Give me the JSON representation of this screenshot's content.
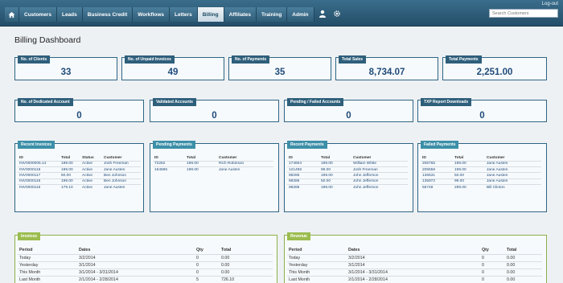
{
  "header": {
    "logout": "Log-out",
    "nav": [
      "Customers",
      "Leads",
      "Business Credit",
      "Workflows",
      "Letters",
      "Billing",
      "Affiliates",
      "Training",
      "Admin"
    ],
    "active": "Billing",
    "search_placeholder": "Search Customers"
  },
  "page_title": "Billing Dashboard",
  "stats_row1": [
    {
      "label": "No. of Clients",
      "value": "33"
    },
    {
      "label": "No. of Unpaid Invoices",
      "value": "49"
    },
    {
      "label": "No. of Payments",
      "value": "35"
    },
    {
      "label": "Total Sales",
      "value": "8,734.07"
    },
    {
      "label": "Total Payments",
      "value": "2,251.00"
    }
  ],
  "stats_row2": [
    {
      "label": "No. of Dedicated Account",
      "value": "0"
    },
    {
      "label": "Validated Accounts",
      "value": "0"
    },
    {
      "label": "Pending / Failed Accounts",
      "value": "0"
    },
    {
      "label": "TXP Report Downloads",
      "value": "0"
    }
  ],
  "recent_invoices": {
    "title": "Recent Invoices",
    "headers": [
      "ID",
      "Total",
      "Status",
      "Customer"
    ],
    "rows": [
      [
        "INV0000005.14",
        "199.00",
        "Active",
        "Josh Freeman"
      ],
      [
        "INV0000118",
        "199.00",
        "Active",
        "Jane Austen"
      ],
      [
        "INV0000117",
        "50.00",
        "Active",
        "Ben Johnson"
      ],
      [
        "INV0000116",
        "199.00",
        "Active",
        "Ben Johnson"
      ],
      [
        "INV0000115",
        "179.10",
        "Active",
        "Jane Austen"
      ]
    ]
  },
  "pending_payments": {
    "title": "Pending Payments",
    "headers": [
      "ID",
      "Total",
      "Customer"
    ],
    "rows": [
      [
        "72262",
        "199.00",
        "Rich Robinson"
      ],
      [
        "164596",
        "199.00",
        "Jane Austen"
      ]
    ]
  },
  "recent_payments": {
    "title": "Recent Payments",
    "headers": [
      "ID",
      "Total",
      "Customer"
    ],
    "rows": [
      [
        "174604",
        "199.00",
        "William White"
      ],
      [
        "121459",
        "99.00",
        "Josh Freeman"
      ],
      [
        "98295",
        "199.00",
        "John Jefferson"
      ],
      [
        "98286",
        "50.00",
        "John Jefferson"
      ],
      [
        "98285",
        "199.00",
        "John Jefferson"
      ]
    ]
  },
  "failed_payments": {
    "title": "Failed Payments",
    "headers": [
      "ID",
      "Total",
      "Customer"
    ],
    "rows": [
      [
        "206765",
        "199.00",
        "Jane Austen"
      ],
      [
        "205558",
        "199.00",
        "Jane Austen"
      ],
      [
        "136531",
        "50.00",
        "Jane Austen"
      ],
      [
        "135972",
        "99.00",
        "Jane Austen"
      ],
      [
        "56748",
        "299.00",
        "Bill Clinton"
      ]
    ]
  },
  "invoices": {
    "title": "Invoices",
    "headers": [
      "Period",
      "Dates",
      "Qty",
      "Total"
    ],
    "rows": [
      [
        "Today",
        "3/2/2014",
        "0",
        "0.00"
      ],
      [
        "Yesterday",
        "3/1/2014",
        "0",
        "0.00"
      ],
      [
        "This Month",
        "3/1/2014 - 3/31/2014",
        "0",
        "0.00"
      ],
      [
        "Last Month",
        "2/1/2014 - 2/28/2014",
        "5",
        "726.10"
      ]
    ]
  },
  "revenue": {
    "title": "Revenue",
    "headers": [
      "Period",
      "Dates",
      "Qty",
      "Total"
    ],
    "rows": [
      [
        "Today",
        "3/2/2014",
        "0",
        "0.00"
      ],
      [
        "Yesterday",
        "3/1/2014",
        "0",
        "0.00"
      ],
      [
        "This Month",
        "3/1/2014 - 3/31/2014",
        "0",
        "0.00"
      ],
      [
        "Last Month",
        "2/1/2014 - 2/28/2014",
        "0",
        "0.00"
      ]
    ]
  }
}
